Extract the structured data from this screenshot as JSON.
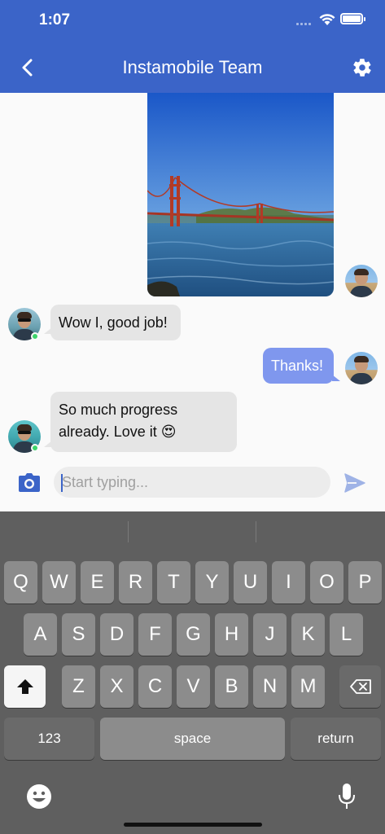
{
  "status_bar": {
    "time": "1:07"
  },
  "header": {
    "title": "Instamobile Team",
    "accent_color": "#3b64c8"
  },
  "messages": [
    {
      "type": "image",
      "sender": "me",
      "alt": ""
    },
    {
      "type": "text",
      "sender": "other",
      "text": "Wow I, good job!"
    },
    {
      "type": "text",
      "sender": "me",
      "text": "Thanks!"
    },
    {
      "type": "text",
      "sender": "other",
      "lines": [
        "So much progress",
        "already. Love it 😍"
      ]
    }
  ],
  "composer": {
    "placeholder": "Start typing...",
    "value": ""
  },
  "keyboard": {
    "row1": [
      "Q",
      "W",
      "E",
      "R",
      "T",
      "Y",
      "U",
      "I",
      "O",
      "P"
    ],
    "row2": [
      "A",
      "S",
      "D",
      "F",
      "G",
      "H",
      "J",
      "K",
      "L"
    ],
    "row3": [
      "Z",
      "X",
      "C",
      "V",
      "B",
      "N",
      "M"
    ],
    "numbers_label": "123",
    "space_label": "space",
    "return_label": "return"
  },
  "colors": {
    "outgoing_bubble": "#7f97ee",
    "incoming_bubble": "#e5e5e5",
    "online": "#3dd46a"
  }
}
